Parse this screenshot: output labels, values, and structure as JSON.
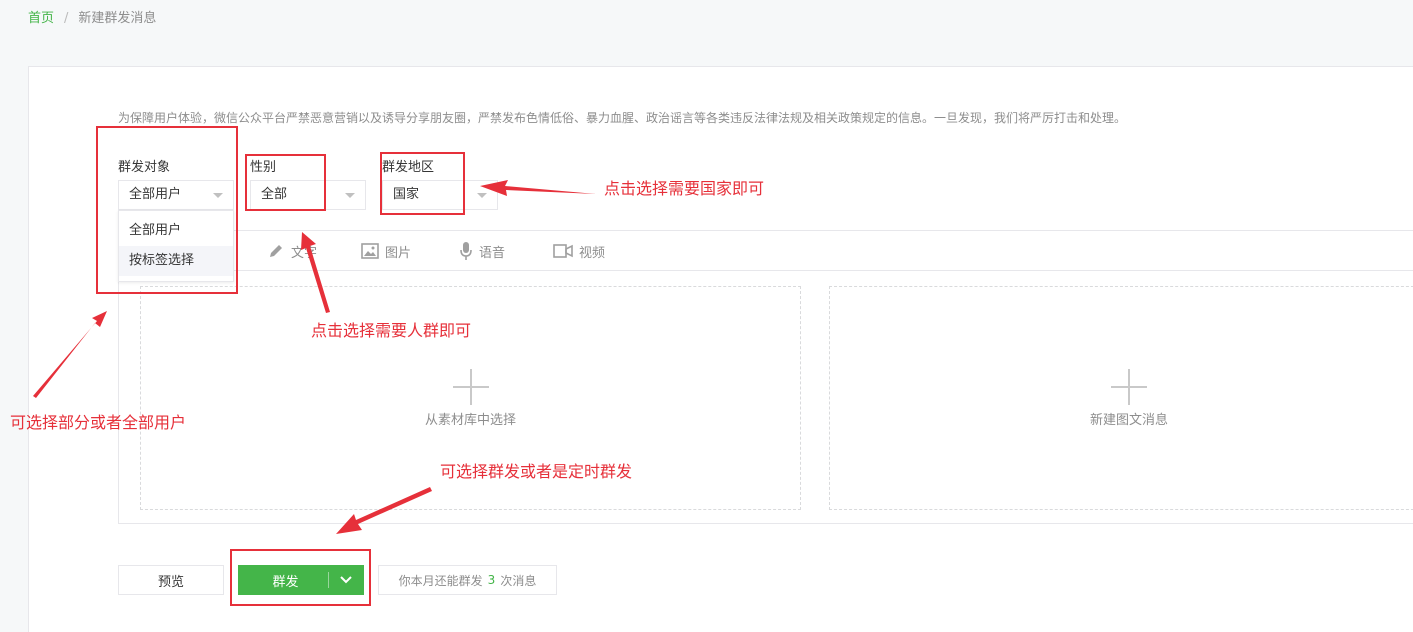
{
  "breadcrumb": {
    "home": "首页",
    "separator": "/",
    "current": "新建群发消息"
  },
  "notice": "为保障用户体验，微信公众平台严禁恶意营销以及诱导分享朋友圈，严禁发布色情低俗、暴力血腥、政治谣言等各类违反法律法规及相关政策规定的信息。一旦发现，我们将严厉打击和处理。",
  "filters": {
    "target": {
      "label": "群发对象",
      "value": "全部用户",
      "options": [
        "全部用户",
        "按标签选择"
      ]
    },
    "gender": {
      "label": "性别",
      "value": "全部"
    },
    "region": {
      "label": "群发地区",
      "value": "国家"
    }
  },
  "tabs": [
    {
      "label": "文字",
      "icon": "pencil-icon"
    },
    {
      "label": "图片",
      "icon": "image-icon"
    },
    {
      "label": "语音",
      "icon": "microphone-icon"
    },
    {
      "label": "视频",
      "icon": "video-icon"
    }
  ],
  "drop_areas": {
    "library": "从素材库中选择",
    "new_article": "新建图文消息"
  },
  "buttons": {
    "preview": "预览",
    "send": "群发"
  },
  "quota": {
    "prefix": "你本月还能群发",
    "count": "3",
    "suffix": "次消息"
  },
  "annotations": {
    "region": "点击选择需要国家即可",
    "gender": "点击选择需要人群即可",
    "target": "可选择部分或者全部用户",
    "send": "可选择群发或者是定时群发"
  },
  "colors": {
    "accent": "#44b549",
    "annotation": "#e6303a"
  }
}
